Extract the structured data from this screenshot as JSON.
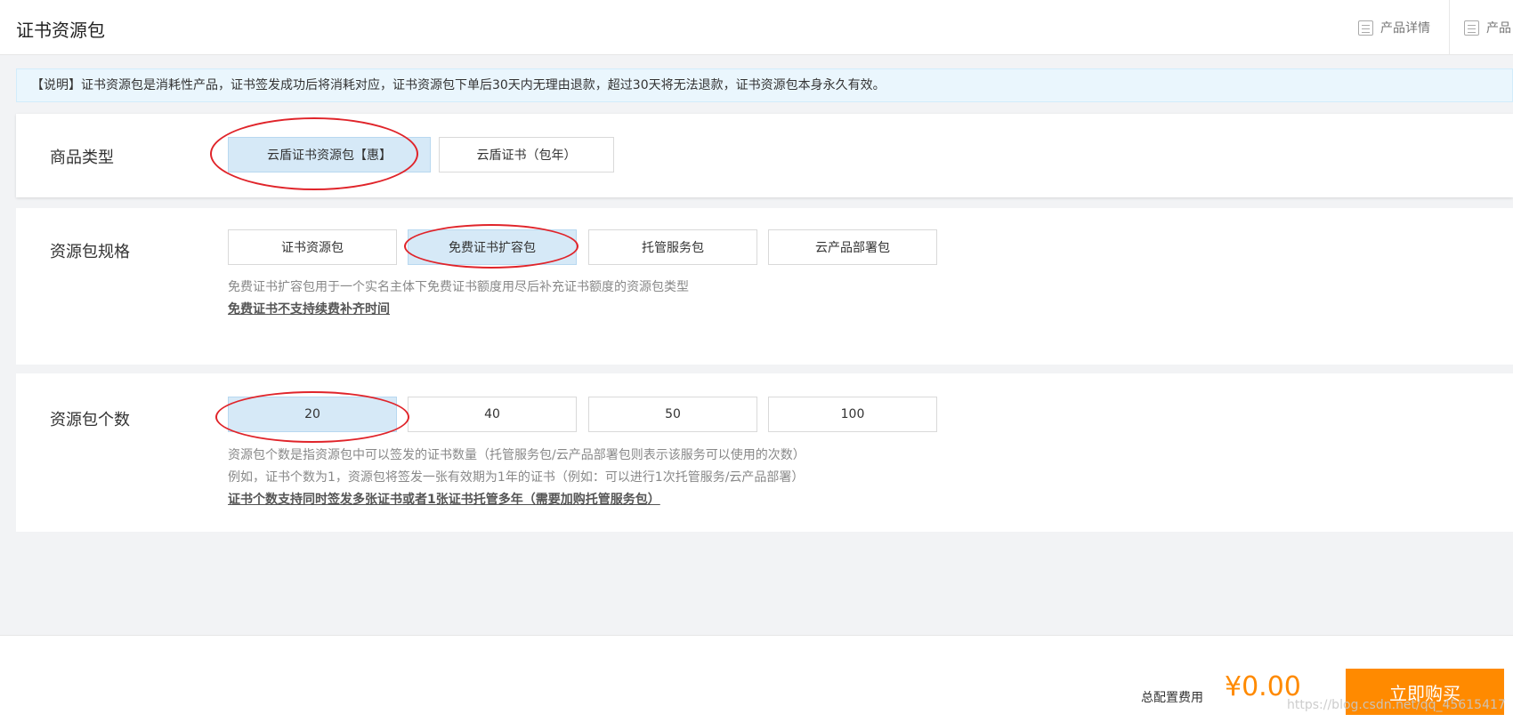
{
  "header": {
    "title": "证书资源包",
    "links": [
      {
        "label": "产品详情",
        "icon": "document-list-icon"
      },
      {
        "label": "产品",
        "icon": "document-icon"
      }
    ]
  },
  "notice": {
    "text": "【说明】证书资源包是消耗性产品，证书签发成功后将消耗对应，证书资源包下单后30天内无理由退款，超过30天将无法退款，证书资源包本身永久有效。"
  },
  "product_type": {
    "label": "商品类型",
    "options": [
      {
        "label": "云盾证书资源包【惠】",
        "selected": true
      },
      {
        "label": "云盾证书（包年）",
        "selected": false
      }
    ]
  },
  "package_spec": {
    "label": "资源包规格",
    "options": [
      {
        "label": "证书资源包",
        "selected": false
      },
      {
        "label": "免费证书扩容包",
        "selected": true
      },
      {
        "label": "托管服务包",
        "selected": false
      },
      {
        "label": "云产品部署包",
        "selected": false
      }
    ],
    "description": "免费证书扩容包用于一个实名主体下免费证书额度用尽后补充证书额度的资源包类型",
    "note_link": "免费证书不支持续费补齐时间"
  },
  "package_count": {
    "label": "资源包个数",
    "options": [
      {
        "label": "20",
        "selected": true
      },
      {
        "label": "40",
        "selected": false
      },
      {
        "label": "50",
        "selected": false
      },
      {
        "label": "100",
        "selected": false
      }
    ],
    "description_1": "资源包个数是指资源包中可以签发的证书数量（托管服务包/云产品部署包则表示该服务可以使用的次数）",
    "description_2": "例如，证书个数为1，资源包将签发一张有效期为1年的证书（例如：可以进行1次托管服务/云产品部署）",
    "note_link": "证书个数支持同时签发多张证书或者1张证书托管多年（需要加购托管服务包）"
  },
  "footer": {
    "total_label": "总配置费用",
    "total_price": "¥0.00",
    "buy_label": "立即购买",
    "watermark": "https://blog.csdn.net/qq_45615417"
  },
  "colors": {
    "accent": "#ff8a00",
    "selected_bg": "#d6e9f7",
    "highlight": "#e0242a",
    "notice_bg": "#eaf6fd"
  }
}
